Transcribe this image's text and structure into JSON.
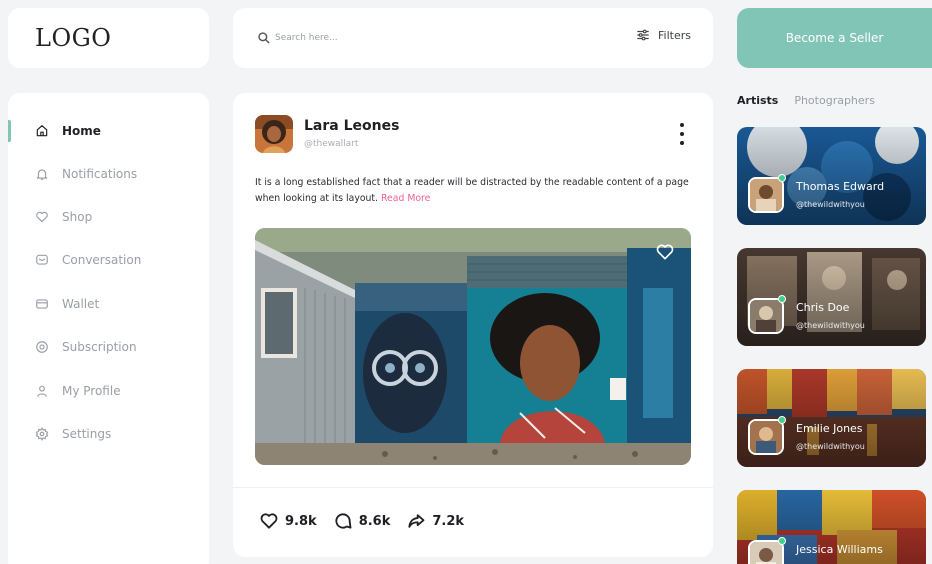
{
  "logo": {
    "text": "LOGO"
  },
  "search": {
    "placeholder": "Search here..."
  },
  "filters": {
    "label": "Filters"
  },
  "seller_button": {
    "label": "Become a Seller"
  },
  "sidebar": {
    "items": [
      {
        "label": "Home",
        "icon": "home-icon",
        "active": true
      },
      {
        "label": "Notifications",
        "icon": "bell-icon",
        "active": false
      },
      {
        "label": "Shop",
        "icon": "heart-icon",
        "active": false
      },
      {
        "label": "Conversation",
        "icon": "chat-icon",
        "active": false
      },
      {
        "label": "Wallet",
        "icon": "wallet-icon",
        "active": false
      },
      {
        "label": "Subscription",
        "icon": "at-icon",
        "active": false
      },
      {
        "label": "My Profile",
        "icon": "user-icon",
        "active": false
      },
      {
        "label": "Settings",
        "icon": "gear-icon",
        "active": false
      }
    ]
  },
  "post": {
    "author": "Lara Leones",
    "handle": "@thewallart",
    "text": "It is a long established fact that a reader will be distracted by the readable content of a page when looking at its layout.",
    "read_more": "Read More",
    "likes": "9.8k",
    "comments": "8.6k",
    "shares": "7.2k"
  },
  "right_panel": {
    "tabs": [
      {
        "label": "Artists",
        "active": true
      },
      {
        "label": "Photographers",
        "active": false
      }
    ],
    "creators": [
      {
        "name": "Thomas Edward",
        "handle": "@thewildwithyou"
      },
      {
        "name": "Chris Doe",
        "handle": "@thewildwithyou"
      },
      {
        "name": "Emilie Jones",
        "handle": "@thewildwithyou"
      },
      {
        "name": "Jessica Williams",
        "handle": ""
      }
    ]
  },
  "colors": {
    "accent": "#80c5b5",
    "link": "#f06292",
    "online": "#3fd08a"
  }
}
